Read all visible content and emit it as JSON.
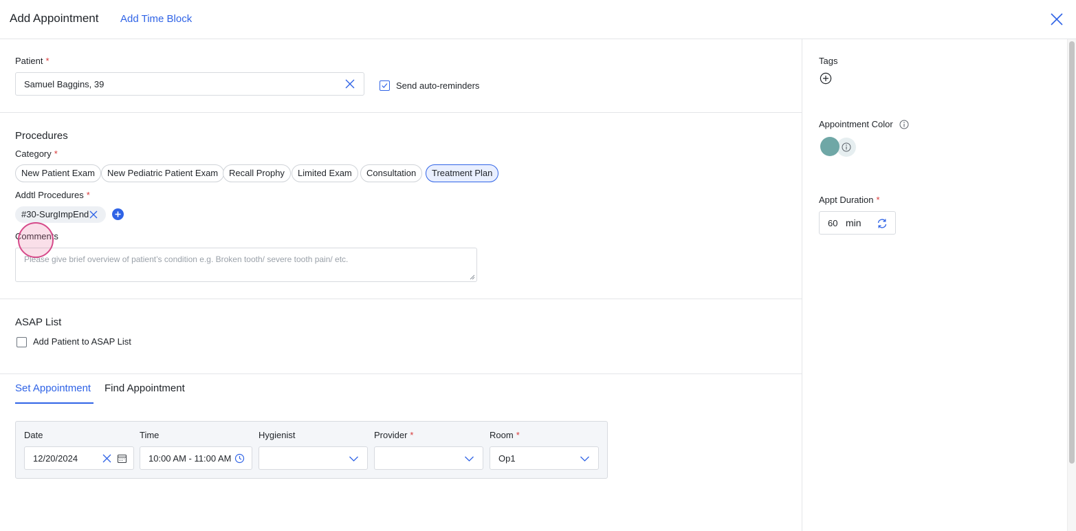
{
  "header": {
    "title": "Add Appointment",
    "alt_link": "Add Time Block",
    "close_icon": "close-icon"
  },
  "patient": {
    "label": "Patient",
    "required_mark": "*",
    "value": "Samuel Baggins, 39",
    "auto_reminders_label": "Send auto-reminders",
    "auto_reminders_checked": true
  },
  "procedures": {
    "title": "Procedures",
    "category_label": "Category",
    "categories": [
      {
        "label": "New Patient Exam",
        "selected": false
      },
      {
        "label": "New Pediatric Patient Exam",
        "selected": false
      },
      {
        "label": "Recall Prophy",
        "selected": false
      },
      {
        "label": "Limited Exam",
        "selected": false
      },
      {
        "label": "Consultation",
        "selected": false
      },
      {
        "label": "Treatment Plan",
        "selected": true
      }
    ],
    "addtl_label": "Addtl Procedures",
    "addtl_items": [
      "#30-SurgImpEnd"
    ],
    "comments_label": "Comments",
    "comments_placeholder": "Please give brief overview of patient’s condition e.g. Broken tooth/ severe tooth pain/ etc."
  },
  "asap": {
    "title": "ASAP List",
    "checkbox_label": "Add Patient to ASAP List",
    "checked": false
  },
  "tabs": [
    {
      "label": "Set Appointment",
      "active": true
    },
    {
      "label": "Find Appointment",
      "active": false
    }
  ],
  "appointment": {
    "date_label": "Date",
    "date_value": "12/20/2024",
    "time_label": "Time",
    "time_value": "10:00 AM - 11:00 AM",
    "hygienist_label": "Hygienist",
    "hygienist_value": "",
    "provider_label": "Provider",
    "provider_value": "",
    "room_label": "Room",
    "room_value": "Op1"
  },
  "sidebar": {
    "tags_label": "Tags",
    "color_label": "Appointment Color",
    "color_value": "#6fa7a6",
    "duration_label": "Appt Duration",
    "duration_value": "60",
    "duration_unit": "min"
  },
  "colors": {
    "accent": "#2f63e6",
    "required": "#d83a3a",
    "selected_chip_bg": "#e9efff"
  }
}
